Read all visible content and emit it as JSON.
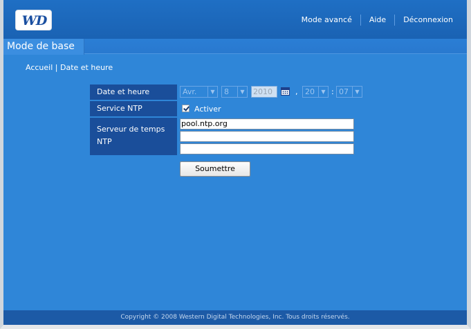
{
  "header": {
    "logo_text": "WD",
    "nav": [
      "Mode avancé",
      "Aide",
      "Déconnexion"
    ]
  },
  "tabs": {
    "active": "Mode de base"
  },
  "breadcrumb": "Accueil | Date et heure",
  "form": {
    "date_label": "Date et heure",
    "month": "Avr.",
    "day": "8",
    "year": "2010",
    "comma": ",",
    "hour": "20",
    "colon": ":",
    "minute": "07",
    "ntp_label": "Service NTP",
    "ntp_checked": true,
    "ntp_checkbox_label": "Activer",
    "server_label": "Serveur de temps NTP",
    "servers": [
      "pool.ntp.org",
      "",
      ""
    ],
    "submit_label": "Soumettre"
  },
  "footer": "Copyright © 2008 Western Digital Technologies, Inc. Tous droits réservés.",
  "colors": {
    "page_bg": "#2f86d8",
    "header_bg": "#1f6fc4",
    "label_bg": "#1a4e9a",
    "footer_bg": "#1c5aa6"
  },
  "icons": [
    "calendar-icon",
    "chevron-down-icon",
    "checkmark-icon"
  ]
}
